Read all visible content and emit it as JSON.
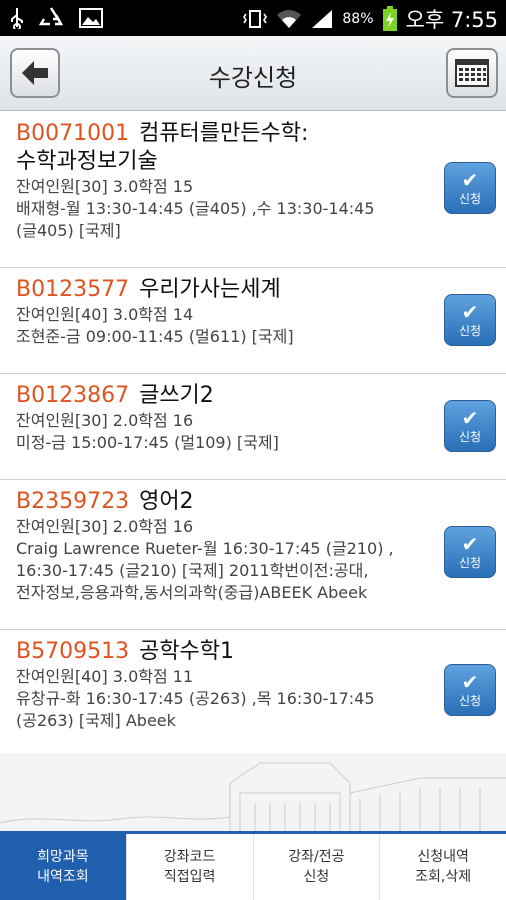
{
  "status_bar": {
    "battery_percent": "88%",
    "time": "오후 7:55"
  },
  "header": {
    "title": "수강신청",
    "back_icon": "arrow-left-icon",
    "calendar_icon": "calendar-icon"
  },
  "courses": [
    {
      "code": "B0071001",
      "name_line1": "컴퓨터를만든수학:",
      "name_line2": "수학과정보기술",
      "info1": "잔여인원[30] 3.0학점 15",
      "info2": "배재형-월 13:30-14:45 (글405) ,수 13:30-14:45",
      "info3": "(글405) [국제]",
      "button_label": "신청"
    },
    {
      "code": "B0123577",
      "name": "우리가사는세계",
      "info1": "잔여인원[40] 3.0학점 14",
      "info2": "조현준-금 09:00-11:45 (멀611) [국제]",
      "button_label": "신청"
    },
    {
      "code": "B0123867",
      "name": "글쓰기2",
      "info1": "잔여인원[30] 2.0학점 16",
      "info2": "미정-금 15:00-17:45 (멀109) [국제]",
      "button_label": "신청"
    },
    {
      "code": "B2359723",
      "name": "영어2",
      "info1": "잔여인원[30] 2.0학점 16",
      "info2": "Craig Lawrence Rueter-월 16:30-17:45 (글210) ,",
      "info3": "16:30-17:45 (글210) [국제] 2011학번이전:공대,",
      "info4": "전자정보,응용과학,동서의과학(중급)ABEEK Abeek",
      "button_label": "신청"
    },
    {
      "code": "B5709513",
      "name": "공학수학1",
      "info1": "잔여인원[40] 3.0학점 11",
      "info2": "유창규-화 16:30-17:45 (공263) ,목 16:30-17:45",
      "info3": "(공263) [국제] Abeek",
      "button_label": "신청"
    }
  ],
  "tabs": [
    {
      "label": "희망과목\n내역조회",
      "active": true
    },
    {
      "label": "강좌코드\n직접입력",
      "active": false
    },
    {
      "label": "강좌/전공\n신청",
      "active": false
    },
    {
      "label": "신청내역\n조회,삭제",
      "active": false
    }
  ],
  "colors": {
    "accent_blue": "#1f5fae",
    "course_code": "#e0531f",
    "apply_button": "#3b82c8"
  }
}
